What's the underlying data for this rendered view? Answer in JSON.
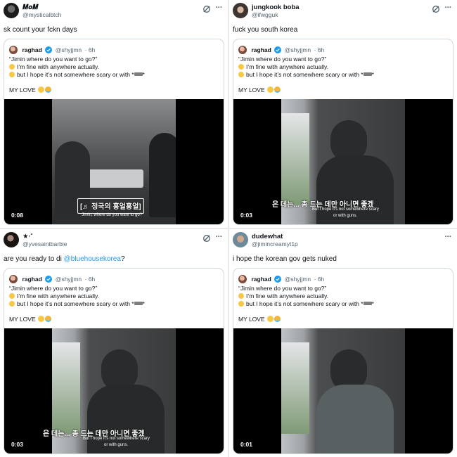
{
  "tweets": [
    {
      "name": "𝑴𝒐𝑴",
      "handle": "@mysticalbtch",
      "text": "sk count your fckn days",
      "quote": {
        "name": "raghad",
        "handle": "@shyjjmn",
        "time": "6h",
        "line1": "“Jimin where do you want to go?”",
        "line2": "I’m fine with anywhere actually.",
        "line3": "but I hope it’s not somewhere scary or with *",
        "line3_end": "*",
        "line4": "MY LOVE",
        "video_time": "0:08",
        "subtitle_ko": "[♬ 정국의 흥얼흥얼]",
        "subtitle_en": "Jimin, where do you want to go?"
      }
    },
    {
      "name": "jungkook boba",
      "handle": "@ifwgguk",
      "text": "fuck you south korea",
      "quote": {
        "name": "raghad",
        "handle": "@shyjjmn",
        "time": "6h",
        "line1": "“Jimin where do you want to go?”",
        "line2": "I’m fine with anywhere actually.",
        "line3": "but I hope it’s not somewhere scary or with *",
        "line3_end": "*",
        "line4": "MY LOVE",
        "video_time": "0:03",
        "subtitle_ko": "은 데는... 총 드는 데만 아니면 좋겠",
        "subtitle_en": "But I hope it’s not somewhere scary",
        "subtitle_en2": "or with guns."
      }
    },
    {
      "name": "★·˚",
      "handle": "@yvesaintbarbie",
      "text": "are you ready to di",
      "text_link": "@bluehousekorea",
      "text_end": "?",
      "quote": {
        "name": "raghad",
        "handle": "@shyjjmn",
        "time": "6h",
        "line1": "“Jimin where do you want to go?”",
        "line2": "I’m fine with anywhere actually.",
        "line3": "but I hope it’s not somewhere scary or with *",
        "line3_end": "*",
        "line4": "MY LOVE",
        "video_time": "0:03",
        "subtitle_ko": "은 데는... 총 드는 데만 아니면 좋겠",
        "subtitle_en": "But I hope it’s not somewhere scary",
        "subtitle_en2": "or with guns."
      }
    },
    {
      "name": "dudewhat",
      "handle": "@jimincreamyt1p",
      "text": "i hope the korean gov gets nuked",
      "quote": {
        "name": "raghad",
        "handle": "@shyjjmn",
        "time": "6h",
        "line1": "“Jimin where do you want to go?”",
        "line2": "I’m fine with anywhere actually.",
        "line3": "but I hope it’s not somewhere scary or with *",
        "line3_end": "*",
        "line4": "MY LOVE",
        "video_time": "0:01"
      }
    }
  ],
  "colors": {
    "link": "#1d9bf0",
    "verified": "#1d9bf0",
    "muted": "#536471"
  },
  "icons": [
    "grok-icon",
    "more-icon",
    "verified-badge-icon",
    "chick-emoji",
    "gun-emoji",
    "pleading-emoji",
    "crying-emoji"
  ]
}
